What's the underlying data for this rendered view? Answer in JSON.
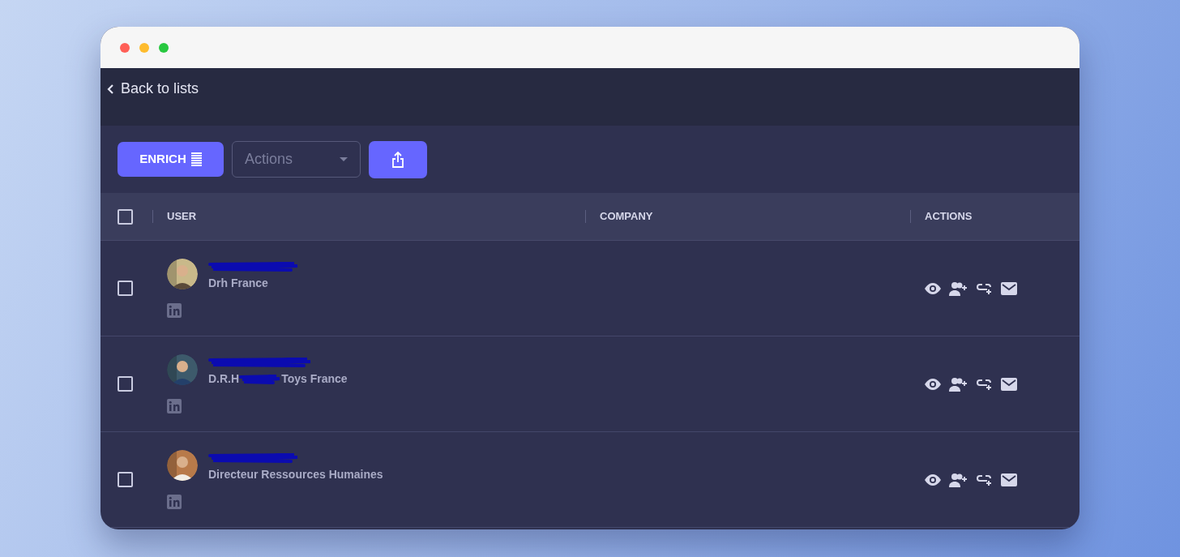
{
  "back_link": "Back to lists",
  "toolbar": {
    "enrich_button": "ENRICH",
    "actions_select": {
      "placeholder": "Actions"
    }
  },
  "table": {
    "select_all": {
      "checked": false
    },
    "columns": [
      "USER",
      "COMPANY",
      "ACTIONS"
    ],
    "rows": [
      {
        "checked": false,
        "title_parts": [
          "Drh France"
        ],
        "avatar": {
          "kind": "picture"
        }
      },
      {
        "checked": false,
        "title_parts": [
          "D.R.H",
          "Toys France"
        ],
        "avatar": {
          "kind": "picture"
        }
      },
      {
        "checked": false,
        "title_parts": [
          "Directeur Ressources Humaines"
        ],
        "avatar": {
          "kind": "picture"
        }
      }
    ]
  }
}
